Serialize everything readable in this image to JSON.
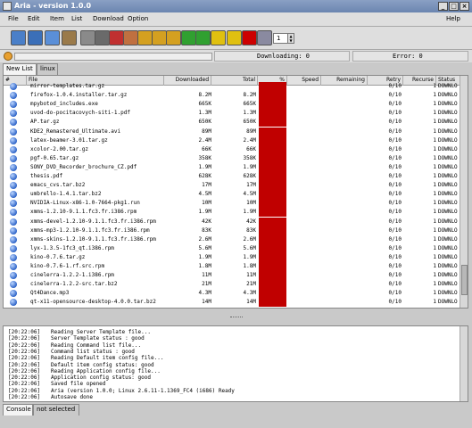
{
  "window": {
    "title": "Aria - version 1.0.0"
  },
  "menu": [
    "File",
    "Edit",
    "Item",
    "List",
    "Download",
    "Option",
    "Help"
  ],
  "toolbar": {
    "icons": [
      "folder-icon",
      "open-icon",
      "save-icon",
      "edit-icon",
      "copy-icon",
      "paste-icon",
      "delete-icon",
      "clear-icon",
      "lock-icon",
      "unlock-icon",
      "lock-all-icon",
      "add-icon",
      "refresh-icon",
      "smiley-icon",
      "star-icon",
      "stop-icon",
      "tools-icon"
    ],
    "colors": [
      "#4a7fc8",
      "#3b6fb8",
      "#5a8fd8",
      "#9a7a4a",
      "#8a8a8a",
      "#6a6a6a",
      "#c03030",
      "#c07040",
      "#d4a020",
      "#d4a020",
      "#d4a020",
      "#30a030",
      "#30a030",
      "#e0c010",
      "#e0c010",
      "#cc0000",
      "#8a8aa0"
    ],
    "spin_value": "1"
  },
  "status": {
    "download_progress": 0,
    "downloading_label": "Downloading: 0",
    "error_label": "Error: 0"
  },
  "tabs": [
    "New List",
    "linux"
  ],
  "columns": [
    "#",
    "File",
    "Downloaded",
    "Total",
    "%",
    "Speed",
    "Remaining",
    "Retry",
    "Recurse",
    "Status"
  ],
  "rows": [
    {
      "file": "mirror-templates.tar.gz",
      "downloaded": "",
      "total": "",
      "retry": "0/10",
      "recurse": "1",
      "status": "DOWNLO"
    },
    {
      "file": "firefox-1.0.4.installer.tar.gz",
      "downloaded": "8.2M",
      "total": "8.2M",
      "retry": "0/10",
      "recurse": "1",
      "status": "DOWNLO"
    },
    {
      "file": "mpybotod_includes.exe",
      "downloaded": "665K",
      "total": "665K",
      "retry": "0/10",
      "recurse": "1",
      "status": "DOWNLO"
    },
    {
      "file": "uvod-do-pocitacovych-siti-1.pdf",
      "downloaded": "1.3M",
      "total": "1.3M",
      "retry": "0/10",
      "recurse": "1",
      "status": "DOWNLO"
    },
    {
      "file": "AP.tar.gz",
      "downloaded": "650K",
      "total": "650K",
      "retry": "0/10",
      "recurse": "1",
      "status": "DOWNLO"
    },
    {
      "file": "KDE2_Remastered_Ultimate.avi",
      "downloaded": "89M",
      "total": "89M",
      "retry": "0/10",
      "recurse": "1",
      "status": "DOWNLO"
    },
    {
      "file": "latex-beamer-3.01.tar.gz",
      "downloaded": "2.4M",
      "total": "2.4M",
      "retry": "0/10",
      "recurse": "1",
      "status": "DOWNLO"
    },
    {
      "file": "xcolor-2.00.tar.gz",
      "downloaded": "66K",
      "total": "66K",
      "retry": "0/10",
      "recurse": "1",
      "status": "DOWNLO"
    },
    {
      "file": "pgf-0.65.tar.gz",
      "downloaded": "358K",
      "total": "358K",
      "retry": "0/10",
      "recurse": "1",
      "status": "DOWNLO"
    },
    {
      "file": "SONY_DVD_Recorder_brochure_CZ.pdf",
      "downloaded": "1.9M",
      "total": "1.9M",
      "retry": "0/10",
      "recurse": "1",
      "status": "DOWNLO"
    },
    {
      "file": "thesis.pdf",
      "downloaded": "628K",
      "total": "628K",
      "retry": "0/10",
      "recurse": "1",
      "status": "DOWNLO"
    },
    {
      "file": "emacs_cvs.tar.bz2",
      "downloaded": "17M",
      "total": "17M",
      "retry": "0/10",
      "recurse": "1",
      "status": "DOWNLO"
    },
    {
      "file": "umbrello-1.4.1.tar.bz2",
      "downloaded": "4.5M",
      "total": "4.5M",
      "retry": "0/10",
      "recurse": "1",
      "status": "DOWNLO"
    },
    {
      "file": "NVIDIA-Linux-x86-1.0-7664-pkg1.run",
      "downloaded": "10M",
      "total": "10M",
      "retry": "0/10",
      "recurse": "1",
      "status": "DOWNLO"
    },
    {
      "file": "xmms-1.2.10-9.1.1.fc3.fr.i386.rpm",
      "downloaded": "1.9M",
      "total": "1.9M",
      "retry": "0/10",
      "recurse": "1",
      "status": "DOWNLO"
    },
    {
      "file": "xmms-devel-1.2.10-9.1.1.fc3.fr.i386.rpm",
      "downloaded": "42K",
      "total": "42K",
      "retry": "0/10",
      "recurse": "1",
      "status": "DOWNLO"
    },
    {
      "file": "xmms-mp3-1.2.10-9.1.1.fc3.fr.i386.rpm",
      "downloaded": "83K",
      "total": "83K",
      "retry": "0/10",
      "recurse": "1",
      "status": "DOWNLO"
    },
    {
      "file": "xmms-skins-1.2.10-9.1.1.fc3.fr.i386.rpm",
      "downloaded": "2.6M",
      "total": "2.6M",
      "retry": "0/10",
      "recurse": "1",
      "status": "DOWNLO"
    },
    {
      "file": "lyx-1.3.5-1fc3_qt.i386.rpm",
      "downloaded": "5.6M",
      "total": "5.6M",
      "retry": "0/10",
      "recurse": "1",
      "status": "DOWNLO"
    },
    {
      "file": "kino-0.7.6.tar.gz",
      "downloaded": "1.9M",
      "total": "1.9M",
      "retry": "0/10",
      "recurse": "1",
      "status": "DOWNLO"
    },
    {
      "file": "kino-0.7.6-1.rf.src.rpm",
      "downloaded": "1.8M",
      "total": "1.8M",
      "retry": "0/10",
      "recurse": "1",
      "status": "DOWNLO"
    },
    {
      "file": "cinelerra-1.2.2-1.i386.rpm",
      "downloaded": "11M",
      "total": "11M",
      "retry": "0/10",
      "recurse": "1",
      "status": "DOWNLO"
    },
    {
      "file": "cinelerra-1.2.2-src.tar.bz2",
      "downloaded": "21M",
      "total": "21M",
      "retry": "0/10",
      "recurse": "1",
      "status": "DOWNLO"
    },
    {
      "file": "Qt4Dance.mp3",
      "downloaded": "4.3M",
      "total": "4.3M",
      "retry": "0/10",
      "recurse": "1",
      "status": "DOWNLO"
    },
    {
      "file": "qt-x11-opensource-desktop-4.0.0.tar.bz2",
      "downloaded": "14M",
      "total": "14M",
      "retry": "0/10",
      "recurse": "1",
      "status": "DOWNLO"
    }
  ],
  "log": [
    {
      "ts": "[20:22:06]",
      "msg": "Reading Server Template file..."
    },
    {
      "ts": "[20:22:06]",
      "msg": "Server Template status : good"
    },
    {
      "ts": "[20:22:06]",
      "msg": "Reading Command list file..."
    },
    {
      "ts": "[20:22:06]",
      "msg": "Command list status : good"
    },
    {
      "ts": "[20:22:06]",
      "msg": "Reading Default item config file..."
    },
    {
      "ts": "[20:22:06]",
      "msg": "Default item config status: good"
    },
    {
      "ts": "[20:22:06]",
      "msg": "Reading Application config file..."
    },
    {
      "ts": "[20:22:06]",
      "msg": "Application config status: good"
    },
    {
      "ts": "[20:22:06]",
      "msg": "Saved file opened"
    },
    {
      "ts": "[20:22:06]",
      "msg": "Aria (version 1.0.0; Linux 2.6.11-1.1369_FC4 (i686) Ready"
    },
    {
      "ts": "[20:22:06]",
      "msg": "Autosave done"
    }
  ],
  "bottom_tabs": [
    "Console",
    "not selected"
  ]
}
